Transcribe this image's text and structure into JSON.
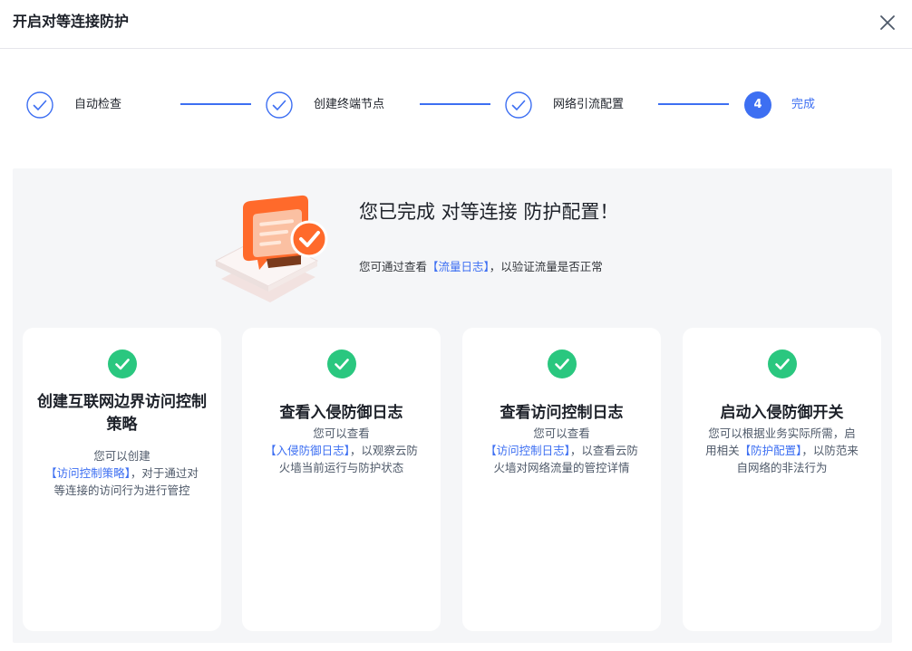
{
  "dialog": {
    "title": "开启对等连接防护",
    "close_icon": "close-icon"
  },
  "steps": [
    {
      "label": "自动检查",
      "status": "done"
    },
    {
      "label": "创建终端节点",
      "status": "done"
    },
    {
      "label": "网络引流配置",
      "status": "done"
    },
    {
      "number": "4",
      "label": "完成",
      "status": "active"
    }
  ],
  "success": {
    "title": "您已完成 对等连接 防护配置！",
    "sub_before": "您可通过查看",
    "sub_link": "【流量日志】",
    "sub_after": "，以验证流量是否正常"
  },
  "cards": [
    {
      "title": "创建互联网边界访问控制策略",
      "desc_before": "您可以创建",
      "link": "【访问控制策略】",
      "desc_after": "，对于通过对等连接的访问行为进行管控"
    },
    {
      "title": "查看入侵防御日志",
      "desc_before": "您可以查看",
      "link": "【入侵防御日志】",
      "desc_after": "，以观察云防火墙当前运行与防护状态"
    },
    {
      "title": "查看访问控制日志",
      "desc_before": "您可以查看",
      "link": "【访问控制日志】",
      "desc_after": "，以查看云防火墙对网络流量的管控详情"
    },
    {
      "title": "启动入侵防御开关",
      "desc_before": "您可以根据业务实际所需，启用相关",
      "link": "【防护配置】",
      "desc_after": "，以防范来自网络的非法行为"
    }
  ],
  "colors": {
    "accent": "#3d6ff2",
    "success": "#2ac77f",
    "panel_bg": "#f5f6f8",
    "illustration_orange": "#ff6a2b"
  }
}
